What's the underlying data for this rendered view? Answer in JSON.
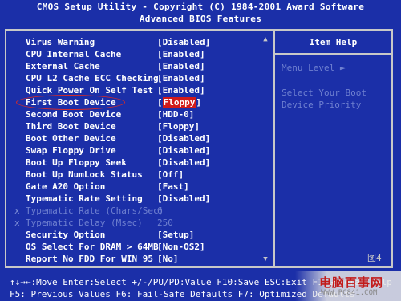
{
  "header": {
    "line1": "CMOS Setup Utility - Copyright (C) 1984-2001 Award Software",
    "line2": "Advanced BIOS Features"
  },
  "settings": [
    {
      "label": "Virus Warning",
      "value": "[Disabled]",
      "marker": ""
    },
    {
      "label": "CPU Internal Cache",
      "value": "[Enabled]",
      "marker": ""
    },
    {
      "label": "External Cache",
      "value": "[Enabled]",
      "marker": ""
    },
    {
      "label": "CPU L2 Cache ECC Checking",
      "value": "[Enabled]",
      "marker": ""
    },
    {
      "label": "Quick Power On Self Test",
      "value": "[Enabled]",
      "marker": ""
    },
    {
      "label": "First Boot Device",
      "value": "[Floppy]",
      "marker": ""
    },
    {
      "label": "Second Boot Device",
      "value": "[HDD-0]",
      "marker": ""
    },
    {
      "label": "Third Boot Device",
      "value": "[Floppy]",
      "marker": ""
    },
    {
      "label": "Boot Other Device",
      "value": "[Disabled]",
      "marker": ""
    },
    {
      "label": "Swap Floppy Drive",
      "value": "[Disabled]",
      "marker": ""
    },
    {
      "label": "Boot Up Floppy Seek",
      "value": "[Disabled]",
      "marker": ""
    },
    {
      "label": "Boot Up NumLock Status",
      "value": "[Off]",
      "marker": ""
    },
    {
      "label": "Gate A20 Option",
      "value": "[Fast]",
      "marker": ""
    },
    {
      "label": "Typematic Rate Setting",
      "value": "[Disabled]",
      "marker": ""
    },
    {
      "label": "Typematic Rate (Chars/Sec)",
      "value": "6",
      "marker": "x"
    },
    {
      "label": "Typematic Delay (Msec)",
      "value": "250",
      "marker": "x"
    },
    {
      "label": "Security Option",
      "value": "[Setup]",
      "marker": ""
    },
    {
      "label": "OS Select For DRAM > 64MB",
      "value": "[Non-OS2]",
      "marker": ""
    },
    {
      "label": "Report No FDD For WIN 95",
      "value": "[No]",
      "marker": ""
    }
  ],
  "selected_index": 5,
  "help": {
    "title": "Item Help",
    "menu_level": "Menu Level   ►",
    "desc_line1": "Select Your Boot",
    "desc_line2": "Device Priority"
  },
  "scroll": {
    "up": "▲",
    "down": "▼"
  },
  "figure_label": "图4",
  "footer": {
    "line1": "↑↓→←:Move  Enter:Select  +/-/PU/PD:Value  F10:Save  ESC:Exit  F1:General Help",
    "line2": "F5: Previous Values   F6: Fail-Safe Defaults   F7: Optimized Defaults"
  },
  "watermark": {
    "text": "电脑百事网",
    "url": "WWW.PC841.COM"
  },
  "colors": {
    "background": "#1b2fa8",
    "highlight": "#d11a1a",
    "dim": "#6f80d0",
    "border": "#c8c8c8"
  }
}
